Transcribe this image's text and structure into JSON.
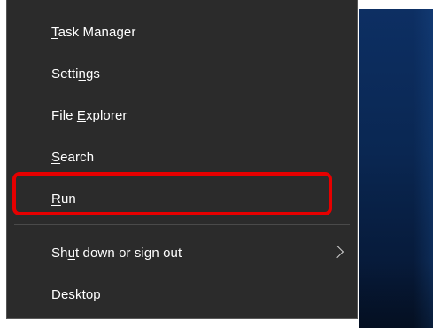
{
  "context_menu": {
    "items": [
      {
        "id": "task-manager",
        "text_before": "",
        "accel": "T",
        "text_after": "ask Manager"
      },
      {
        "id": "settings",
        "text_before": "Setti",
        "accel": "n",
        "text_after": "gs"
      },
      {
        "id": "file-explorer",
        "text_before": "File ",
        "accel": "E",
        "text_after": "xplorer"
      },
      {
        "id": "search",
        "text_before": "",
        "accel": "S",
        "text_after": "earch"
      },
      {
        "id": "run",
        "text_before": "",
        "accel": "R",
        "text_after": "un"
      },
      {
        "id": "shut-down",
        "text_before": "Sh",
        "accel": "u",
        "text_after": "t down or sign out",
        "has_submenu": true,
        "submenu_icon": "chevron-right-icon"
      },
      {
        "id": "desktop",
        "text_before": "",
        "accel": "D",
        "text_after": "esktop"
      }
    ],
    "highlighted_item": "run",
    "highlight_color": "#e60000",
    "menu_background": "#2b2b2b",
    "text_color": "#ffffff"
  }
}
